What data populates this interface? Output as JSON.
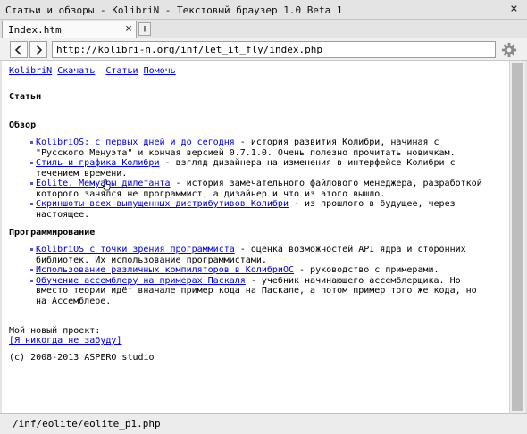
{
  "window": {
    "title": "Статьи и обзоры - KolibriN - Текстовый браузер 1.0 Beta 1",
    "close_glyph": "×"
  },
  "tabs": {
    "items": [
      {
        "label": "Index.htm",
        "close_glyph": "×"
      }
    ],
    "add_glyph": "+"
  },
  "toolbar": {
    "url": "http://kolibri-n.org/inf/let_it_fly/index.php"
  },
  "page": {
    "nav": [
      "KolibriN",
      "Скачать",
      "Статьи",
      "Помочь"
    ],
    "heading": "Статьи",
    "sections": [
      {
        "title": "Обзор",
        "items": [
          {
            "link": "KolibriOS: с первых дней и до сегодня",
            "text": " - история развития Колибри, начиная с \"Русского Менуэта\" и кончая версией 0.7.1.0. Очень полезно прочитать новичкам."
          },
          {
            "link": "Стиль и графика Колибри",
            "text": " - взгляд дизайнера на изменения в интерфейсе Колибри с течением времени."
          },
          {
            "link": "Eolite. Мемуары дилетанта",
            "text": " - история замечательного файлового менеджера, разработкой которого занялся не программист, а дизайнер и что из этого вышло."
          },
          {
            "link": "Скриншоты всех выпущенных дистрибутивов Колибри",
            "text": " - из прошлого в будущее, через настоящее."
          }
        ]
      },
      {
        "title": "Программирование",
        "items": [
          {
            "link": "KolibriOS с точки зрения программиста",
            "text": " - оценка возможностей API ядра и сторонних библиотек. Их использование программистами."
          },
          {
            "link": "Использование различных компиляторов в КолибриОС",
            "text": " - руководство с примерами."
          },
          {
            "link": "Обучение ассемблеру на примерах Паскаля",
            "text": " - учебник начинающего ассемблерщика. Но вместо теории идёт вначале пример кода на Паскале, а потом пример того же кода, но на Ассемблере."
          }
        ]
      }
    ],
    "project_label": "Мой новый проект:",
    "project_link": "[Я никогда не забуду]",
    "copyright": "(c) 2008-2013 ASPERO studio"
  },
  "status": {
    "text": "/inf/eolite/eolite_p1.php"
  },
  "icons": {
    "back": "chevron-left-icon",
    "forward": "chevron-right-icon",
    "settings": "gear-icon"
  }
}
